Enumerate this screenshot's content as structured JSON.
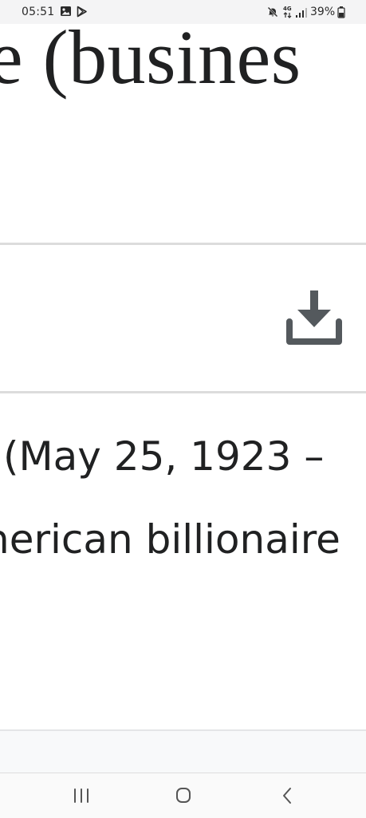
{
  "status_bar": {
    "time": "05:51",
    "network_type": "4G",
    "battery_percent": "39%",
    "icons": [
      "gallery-icon",
      "play-store-icon",
      "mute-icon",
      "network-4g-icon",
      "signal-icon",
      "battery-icon"
    ]
  },
  "article": {
    "title_fragment": "e (busines",
    "lead_line_1": "(May 25, 1923 –",
    "lead_line_2": "nerican billionaire"
  },
  "toolbar": {
    "download_icon": "download-icon"
  },
  "system_nav": {
    "buttons": [
      "recent-apps-icon",
      "home-icon",
      "back-icon"
    ]
  },
  "colors": {
    "text": "#202122",
    "icon_gray": "#54595d",
    "divider": "#dcdcdc",
    "status_bar_bg": "#f4f4f5"
  }
}
